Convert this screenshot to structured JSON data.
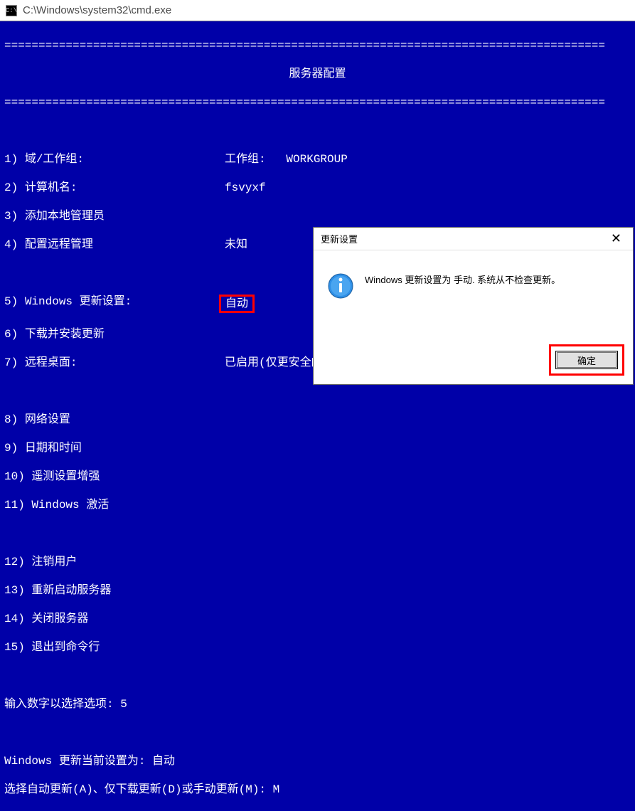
{
  "titlebar": {
    "icon_label": "CMD",
    "path": "C:\\Windows\\system32\\cmd.exe"
  },
  "separator": "========================================================================================",
  "header_title": "服务器配置",
  "menu": {
    "item1": {
      "num": "1)",
      "label": "域/工作组:",
      "value_label": "工作组:",
      "value": "WORKGROUP"
    },
    "item2": {
      "num": "2)",
      "label": "计算机名:",
      "value": "fsvyxf"
    },
    "item3": {
      "num": "3)",
      "label": "添加本地管理员"
    },
    "item4": {
      "num": "4)",
      "label": "配置远程管理",
      "value": "未知"
    },
    "item5": {
      "num": "5)",
      "label": "Windows 更新设置:",
      "value": "自动"
    },
    "item6": {
      "num": "6)",
      "label": "下载并安装更新"
    },
    "item7": {
      "num": "7)",
      "label": "远程桌面:",
      "value": "已启用(仅更安全的客户端)"
    },
    "item8": {
      "num": "8)",
      "label": "网络设置"
    },
    "item9": {
      "num": "9)",
      "label": "日期和时间"
    },
    "item10": {
      "num": "10)",
      "label": "遥测设置增强"
    },
    "item11": {
      "num": "11)",
      "label": "Windows 激活"
    },
    "item12": {
      "num": "12)",
      "label": "注销用户"
    },
    "item13": {
      "num": "13)",
      "label": "重新启动服务器"
    },
    "item14": {
      "num": "14)",
      "label": "关闭服务器"
    },
    "item15": {
      "num": "15)",
      "label": "退出到命令行"
    }
  },
  "prompt": {
    "text": "输入数字以选择选项:",
    "input": "5"
  },
  "status": {
    "current": "Windows 更新当前设置为: 自动",
    "choose": "选择自动更新(A)、仅下载更新(D)或手动更新(M):",
    "input": "M"
  },
  "dialog": {
    "title": "更新设置",
    "message": "Windows 更新设置为 手动. 系统从不检查更新。",
    "ok": "确定",
    "close": "✕"
  }
}
